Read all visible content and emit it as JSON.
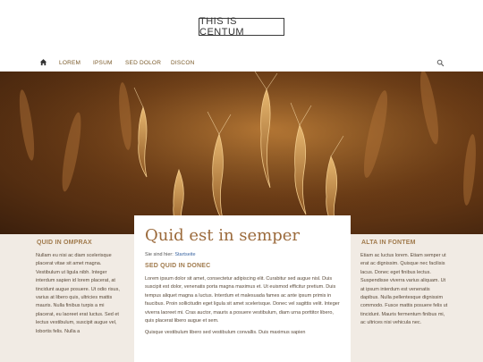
{
  "header": {
    "logo_text": "THIS IS CENTUM"
  },
  "nav": {
    "home_icon": "home-icon",
    "items": [
      {
        "label": "LOREM"
      },
      {
        "label": "IPSUM"
      },
      {
        "label": "SED DOLOR"
      },
      {
        "label": "DISCON"
      }
    ],
    "search_icon": "search-icon"
  },
  "hero": {
    "image": "wheat-field-photo"
  },
  "left_column": {
    "title": "QUID IN OMPRAX",
    "text": "Nullam eu nisi ac diam scelerisque placerat vitae sit amet magna. Vestibulum ut ligula nibh. Integer interdum sapien id lorem placerat, at tincidunt augue posuere. Ut odio risus, varius at libero quis, ultricies mattis mauris. Nulla finibus turpis a mi placerat, eu laoreet erat luctus. Sed et lectus vestibulum, suscipit augue vel, lobortis felis. Nulla a"
  },
  "main": {
    "title": "Quid est in semper",
    "breadcrumb_prefix": "Sie sind hier:",
    "breadcrumb_link": "Startseite",
    "subtitle": "SED QUID IN DONEC",
    "paragraph1": "Lorem ipsum dolor sit amet, consectetur adipiscing elit. Curabitur sed augue nisl. Duis suscipit est dolor, venenatis porta magna maximus et. Ut euismod efficitur pretium. Duis tempus aliquet magna a luctus. Interdum et malesuada fames ac ante ipsum primis in faucibus. Proin sollicitudin eget ligula sit amet scelerisque. Donec vel sagittis velit. Integer viverra laoreet mi. Cras auctor, mauris a posuere vestibulum, diam urna porttitor libero, quis placerat libero augue et sem.",
    "paragraph2": "Quisque vestibulum libero sed vestibulum convallis. Duis maximus sapien"
  },
  "right_column": {
    "title": "ALTA IN FONTEM",
    "text": "Etiam ac luctus lorem. Etiam semper ut erat ac dignissim. Quisque nec facilisis lacus. Donec eget finibus lectus. Suspendisse viverra varius aliquam. Ut at ipsum interdum est venenatis dapibus. Nulla pellentesque dignissim commodo. Fusce mattis posuere felis ut tincidunt. Mauris fermentum finibus mi, ac ultrices nisi vehicula nec."
  }
}
